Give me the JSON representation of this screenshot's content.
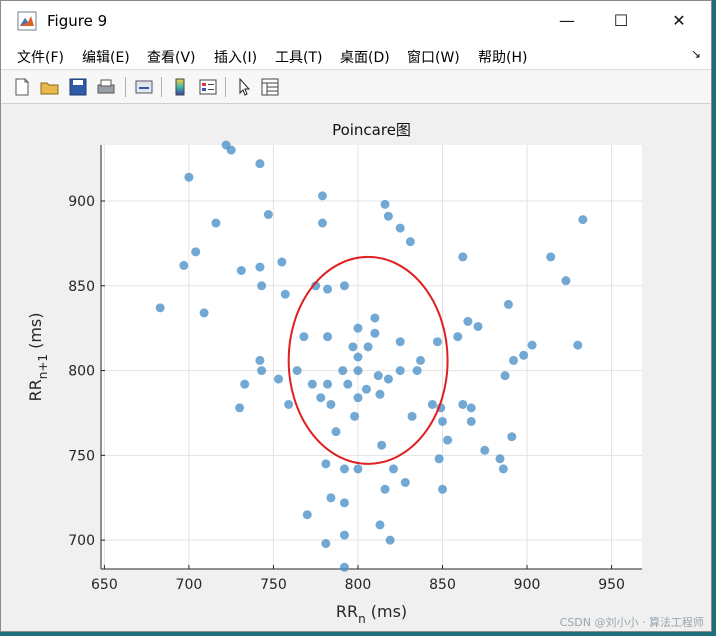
{
  "window": {
    "title": "Figure 9",
    "controls": {
      "minimize": "—",
      "maximize": "☐",
      "close": "✕"
    }
  },
  "menu": {
    "items": [
      "文件(F)",
      "编辑(E)",
      "查看(V)",
      "插入(I)",
      "工具(T)",
      "桌面(D)",
      "窗口(W)",
      "帮助(H)"
    ],
    "overflow_arrow": "↘"
  },
  "toolbar": {
    "icons": [
      "new-figure-icon",
      "open-file-icon",
      "save-icon",
      "print-icon",
      "link-icon",
      "colorbar-icon",
      "legend-icon",
      "pointer-icon",
      "property-inspector-icon"
    ]
  },
  "watermark": "CSDN @刘小小 · 算法工程师",
  "chart_data": {
    "type": "scatter",
    "title": "Poincare图",
    "xlabel": "RR",
    "xlabel_sub": "n",
    "xlabel_unit": " (ms)",
    "ylabel": "RR",
    "ylabel_sub": "n+1",
    "ylabel_unit": " (ms)",
    "xlim": [
      648,
      968
    ],
    "ylim": [
      683,
      933
    ],
    "xticks": [
      650,
      700,
      750,
      800,
      850,
      900,
      950
    ],
    "yticks": [
      700,
      750,
      800,
      850,
      900
    ],
    "grid": true,
    "marker_color": "#4a90c8",
    "annotation_color": "#e02020",
    "annotation": {
      "type": "ellipse",
      "cx": 806,
      "cy": 806,
      "rx": 47,
      "ry": 61
    },
    "points": [
      [
        722,
        933
      ],
      [
        725,
        930
      ],
      [
        742,
        922
      ],
      [
        700,
        914
      ],
      [
        779,
        903
      ],
      [
        816,
        898
      ],
      [
        933,
        889
      ],
      [
        747,
        892
      ],
      [
        818,
        891
      ],
      [
        716,
        887
      ],
      [
        779,
        887
      ],
      [
        825,
        884
      ],
      [
        831,
        876
      ],
      [
        704,
        870
      ],
      [
        862,
        867
      ],
      [
        914,
        867
      ],
      [
        697,
        862
      ],
      [
        755,
        864
      ],
      [
        742,
        861
      ],
      [
        731,
        859
      ],
      [
        923,
        853
      ],
      [
        743,
        850
      ],
      [
        775,
        850
      ],
      [
        792,
        850
      ],
      [
        782,
        848
      ],
      [
        757,
        845
      ],
      [
        889,
        839
      ],
      [
        683,
        837
      ],
      [
        709,
        834
      ],
      [
        810,
        831
      ],
      [
        865,
        829
      ],
      [
        871,
        826
      ],
      [
        800,
        825
      ],
      [
        810,
        822
      ],
      [
        768,
        820
      ],
      [
        782,
        820
      ],
      [
        859,
        820
      ],
      [
        825,
        817
      ],
      [
        847,
        817
      ],
      [
        903,
        815
      ],
      [
        930,
        815
      ],
      [
        797,
        814
      ],
      [
        806,
        814
      ],
      [
        800,
        808
      ],
      [
        898,
        809
      ],
      [
        892,
        806
      ],
      [
        742,
        806
      ],
      [
        837,
        806
      ],
      [
        791,
        800
      ],
      [
        800,
        800
      ],
      [
        825,
        800
      ],
      [
        835,
        800
      ],
      [
        743,
        800
      ],
      [
        764,
        800
      ],
      [
        812,
        797
      ],
      [
        887,
        797
      ],
      [
        818,
        795
      ],
      [
        753,
        795
      ],
      [
        733,
        792
      ],
      [
        773,
        792
      ],
      [
        782,
        792
      ],
      [
        794,
        792
      ],
      [
        805,
        789
      ],
      [
        813,
        786
      ],
      [
        778,
        784
      ],
      [
        800,
        784
      ],
      [
        759,
        780
      ],
      [
        784,
        780
      ],
      [
        844,
        780
      ],
      [
        862,
        780
      ],
      [
        867,
        778
      ],
      [
        730,
        778
      ],
      [
        849,
        778
      ],
      [
        798,
        773
      ],
      [
        832,
        773
      ],
      [
        867,
        770
      ],
      [
        850,
        770
      ],
      [
        787,
        764
      ],
      [
        891,
        761
      ],
      [
        853,
        759
      ],
      [
        814,
        756
      ],
      [
        875,
        753
      ],
      [
        848,
        748
      ],
      [
        884,
        748
      ],
      [
        781,
        745
      ],
      [
        821,
        742
      ],
      [
        792,
        742
      ],
      [
        800,
        742
      ],
      [
        886,
        742
      ],
      [
        828,
        734
      ],
      [
        816,
        730
      ],
      [
        850,
        730
      ],
      [
        784,
        725
      ],
      [
        792,
        722
      ],
      [
        770,
        715
      ],
      [
        813,
        709
      ],
      [
        792,
        703
      ],
      [
        781,
        698
      ],
      [
        819,
        700
      ],
      [
        792,
        684
      ]
    ]
  }
}
